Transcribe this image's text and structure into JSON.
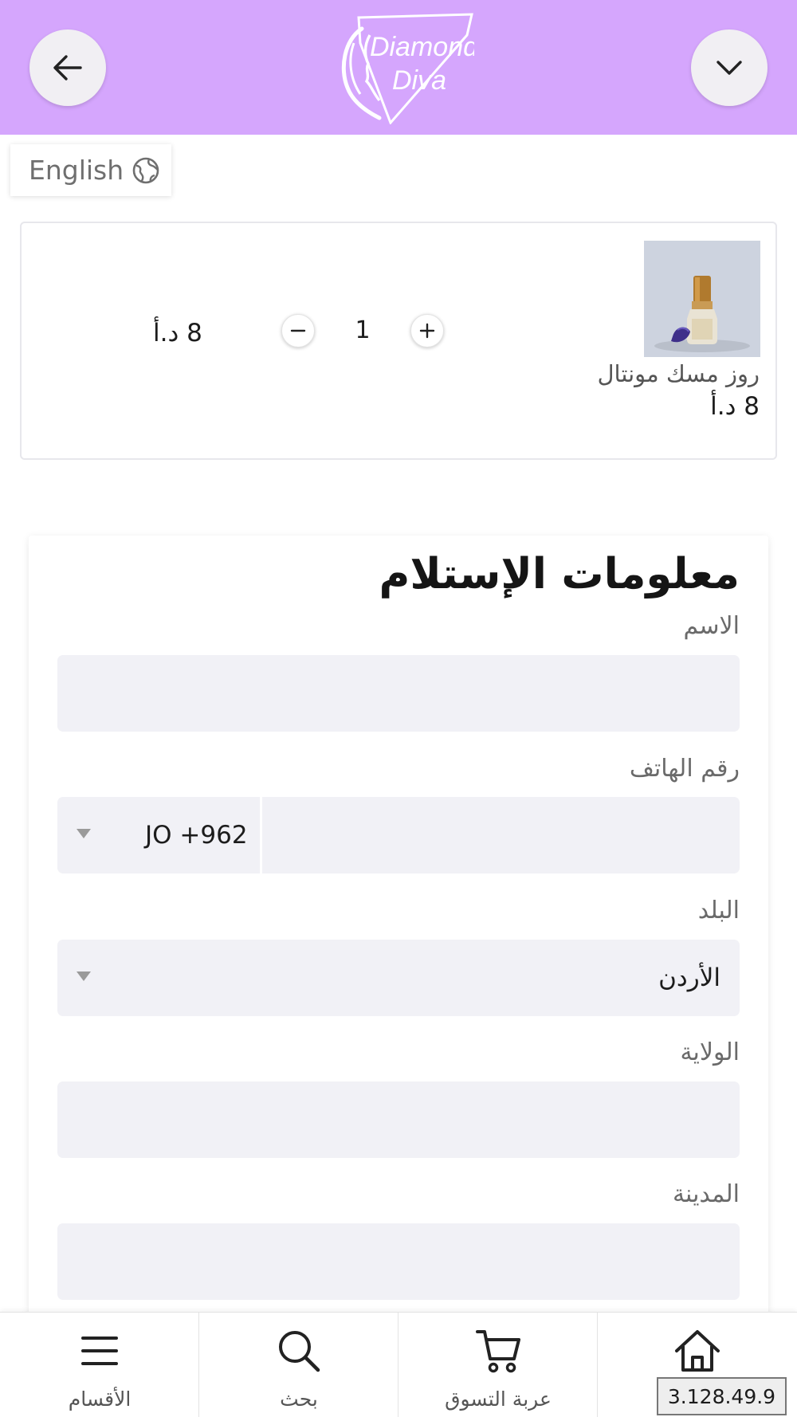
{
  "colors": {
    "header_bg": "#d5a6fd",
    "field_bg": "#f1f1f6",
    "text_dark": "#1c1c1c",
    "text_muted": "#6a6a6a"
  },
  "header": {
    "back_icon": "arrow-left-icon",
    "menu_icon": "chevron-down-icon",
    "logo_line1": "Diamond",
    "logo_line2": "Diva"
  },
  "language": {
    "label": "English",
    "icon": "globe-icon"
  },
  "cart": {
    "item": {
      "name": "روز مسك مونتال",
      "price": "8 د.أ",
      "quantity": "1",
      "total": "8 د.أ"
    }
  },
  "form": {
    "title": "معلومات الإستلام",
    "name_label": "الاسم",
    "phone_label": "رقم الهاتف",
    "phone_code": "JO +962",
    "country_label": "البلد",
    "country_value": "الأردن",
    "state_label": "الولاية",
    "city_label": "المدينة"
  },
  "bottom_nav": {
    "categories": "الأقسام",
    "search": "بحث",
    "cart": "عربة التسوق",
    "home_icon": "home-icon"
  },
  "ip_badge": "3.128.49.9"
}
